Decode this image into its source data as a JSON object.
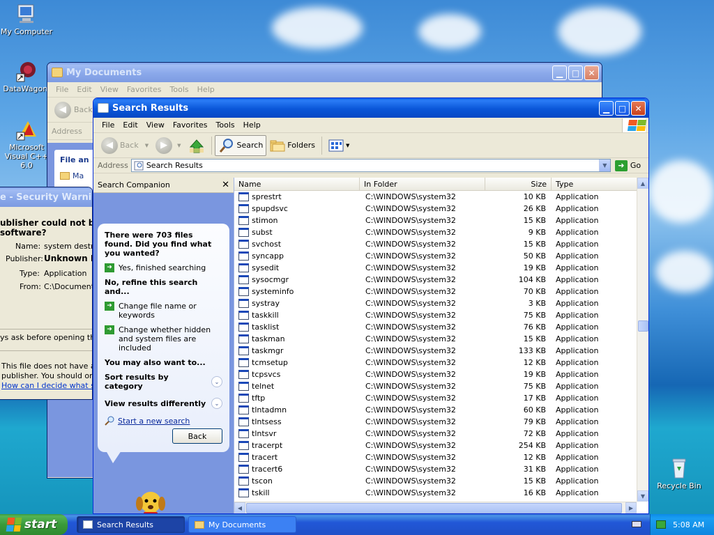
{
  "desktop": {
    "icons": [
      {
        "label": "My Computer"
      },
      {
        "label": "DataWagon."
      },
      {
        "label": "Microsoft Visual C++ 6.0"
      },
      {
        "label": "Recycle Bin"
      }
    ]
  },
  "mydocs": {
    "title": "My Documents",
    "menu": [
      "File",
      "Edit",
      "View",
      "Favorites",
      "Tools",
      "Help"
    ],
    "back_label": "Back",
    "address_label": "Address",
    "file_and_label": "File an",
    "ma_label": "Ma"
  },
  "security_warning": {
    "title": "e - Security Warning",
    "heading_line1": "ublisher could not be ver",
    "heading_line2": "software?",
    "name_label": "Name:",
    "name_value": "system destro",
    "publisher_label": "Publisher:",
    "publisher_value": "Unknown Pu",
    "type_label": "Type:",
    "type_value": "Application",
    "from_label": "From:",
    "from_value": "C:\\Documents",
    "ask_text": "ys ask before opening this file",
    "note_line1": "This file does not have a va",
    "note_line2": "publisher. You should only",
    "help_link": "How can I decide what soft"
  },
  "search": {
    "title": "Search Results",
    "menu": [
      "File",
      "Edit",
      "View",
      "Favorites",
      "Tools",
      "Help"
    ],
    "toolbar": {
      "back": "Back",
      "search": "Search",
      "folders": "Folders"
    },
    "address_label": "Address",
    "address_value": "Search Results",
    "go_label": "Go",
    "companion_title": "Search Companion",
    "companion": {
      "found_text": "There were 703 files found. Did you find what you wanted?",
      "yes_option": "Yes, finished searching",
      "refine_heading": "No, refine this search and...",
      "change_name": "Change file name or keywords",
      "change_hidden": "Change whether hidden and system files are included",
      "also_heading": "You may also want to...",
      "sort_results": "Sort results by category",
      "view_results": "View results differently",
      "new_search": "Start a new search",
      "back_button": "Back"
    },
    "columns": {
      "name": "Name",
      "folder": "In Folder",
      "size": "Size",
      "type": "Type"
    },
    "rows": [
      {
        "name": "sprestrt",
        "folder": "C:\\WINDOWS\\system32",
        "size": "10 KB",
        "type": "Application"
      },
      {
        "name": "spupdsvc",
        "folder": "C:\\WINDOWS\\system32",
        "size": "26 KB",
        "type": "Application"
      },
      {
        "name": "stimon",
        "folder": "C:\\WINDOWS\\system32",
        "size": "15 KB",
        "type": "Application"
      },
      {
        "name": "subst",
        "folder": "C:\\WINDOWS\\system32",
        "size": "9 KB",
        "type": "Application"
      },
      {
        "name": "svchost",
        "folder": "C:\\WINDOWS\\system32",
        "size": "15 KB",
        "type": "Application"
      },
      {
        "name": "syncapp",
        "folder": "C:\\WINDOWS\\system32",
        "size": "50 KB",
        "type": "Application"
      },
      {
        "name": "sysedit",
        "folder": "C:\\WINDOWS\\system32",
        "size": "19 KB",
        "type": "Application"
      },
      {
        "name": "sysocmgr",
        "folder": "C:\\WINDOWS\\system32",
        "size": "104 KB",
        "type": "Application"
      },
      {
        "name": "systeminfo",
        "folder": "C:\\WINDOWS\\system32",
        "size": "70 KB",
        "type": "Application"
      },
      {
        "name": "systray",
        "folder": "C:\\WINDOWS\\system32",
        "size": "3 KB",
        "type": "Application"
      },
      {
        "name": "taskkill",
        "folder": "C:\\WINDOWS\\system32",
        "size": "75 KB",
        "type": "Application"
      },
      {
        "name": "tasklist",
        "folder": "C:\\WINDOWS\\system32",
        "size": "76 KB",
        "type": "Application"
      },
      {
        "name": "taskman",
        "folder": "C:\\WINDOWS\\system32",
        "size": "15 KB",
        "type": "Application"
      },
      {
        "name": "taskmgr",
        "folder": "C:\\WINDOWS\\system32",
        "size": "133 KB",
        "type": "Application"
      },
      {
        "name": "tcmsetup",
        "folder": "C:\\WINDOWS\\system32",
        "size": "12 KB",
        "type": "Application"
      },
      {
        "name": "tcpsvcs",
        "folder": "C:\\WINDOWS\\system32",
        "size": "19 KB",
        "type": "Application"
      },
      {
        "name": "telnet",
        "folder": "C:\\WINDOWS\\system32",
        "size": "75 KB",
        "type": "Application"
      },
      {
        "name": "tftp",
        "folder": "C:\\WINDOWS\\system32",
        "size": "17 KB",
        "type": "Application"
      },
      {
        "name": "tlntadmn",
        "folder": "C:\\WINDOWS\\system32",
        "size": "60 KB",
        "type": "Application"
      },
      {
        "name": "tlntsess",
        "folder": "C:\\WINDOWS\\system32",
        "size": "79 KB",
        "type": "Application"
      },
      {
        "name": "tlntsvr",
        "folder": "C:\\WINDOWS\\system32",
        "size": "72 KB",
        "type": "Application"
      },
      {
        "name": "tracerpt",
        "folder": "C:\\WINDOWS\\system32",
        "size": "254 KB",
        "type": "Application"
      },
      {
        "name": "tracert",
        "folder": "C:\\WINDOWS\\system32",
        "size": "12 KB",
        "type": "Application"
      },
      {
        "name": "tracert6",
        "folder": "C:\\WINDOWS\\system32",
        "size": "31 KB",
        "type": "Application"
      },
      {
        "name": "tscon",
        "folder": "C:\\WINDOWS\\system32",
        "size": "15 KB",
        "type": "Application"
      },
      {
        "name": "tskill",
        "folder": "C:\\WINDOWS\\system32",
        "size": "16 KB",
        "type": "Application"
      }
    ]
  },
  "taskbar": {
    "start_label": "start",
    "items": [
      {
        "label": "Search Results"
      },
      {
        "label": "My Documents"
      }
    ],
    "clock": "5:08 AM"
  },
  "colors": {
    "titlebar_active": "#0a56d8",
    "taskbar": "#2157d7",
    "start_green": "#3a9a3a",
    "companion_blue": "#7a96df"
  }
}
